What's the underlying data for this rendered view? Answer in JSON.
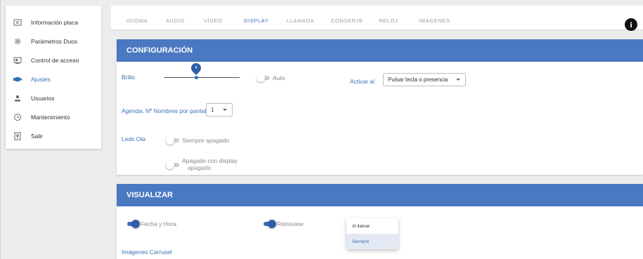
{
  "sidebar": {
    "items": [
      {
        "label": "Información placa",
        "icon": "board-info-icon"
      },
      {
        "label": "Parámetros Duox",
        "icon": "gear-icon"
      },
      {
        "label": "Control de acceso",
        "icon": "access-control-icon"
      },
      {
        "label": "Ajustes",
        "icon": "settings-sliders-icon"
      },
      {
        "label": "Usuarios",
        "icon": "user-icon"
      },
      {
        "label": "Mantenimiento",
        "icon": "maintenance-clock-icon"
      },
      {
        "label": "Salir",
        "icon": "exit-icon"
      }
    ],
    "active_index": 3
  },
  "tabs": [
    "IDIOMA",
    "AUDIO",
    "VÍDEO",
    "DISPLAY",
    "LLAMADA",
    "CONSERJE",
    "RELOJ",
    "IMÁGENES"
  ],
  "active_tab": "DISPLAY",
  "info_button": "i",
  "config": {
    "title": "CONFIGURACIÓN",
    "brillo_label": "Brillo",
    "brillo_value": "4",
    "brillo_fraction": 0.43,
    "auto_label": "Auto",
    "auto_on": false,
    "activar_label": "Activar al",
    "activar_value": "Pulsar tecla o presencia",
    "agenda_label": "Agenda. Nº Nombres por pantalla",
    "agenda_value": "1",
    "leds_label": "Leds Ola",
    "leds_option1": "Siempre apagado",
    "leds_option2_line1": "Apagado con display",
    "leds_option2_line2": "apagado"
  },
  "visualizar": {
    "title": "VISUALIZAR",
    "fecha_label": "Fecha y Hora",
    "fecha_on": true,
    "retroview_label": "Retroview",
    "retroview_on": true,
    "menu_options": [
      "Al llamar",
      "Siempre"
    ],
    "menu_selected": "Siempre",
    "carrusel_label": "Imágenes Carrusel"
  },
  "colors": {
    "accent": "#3a6fb7",
    "header_bar": "#4a78c1",
    "background": "#ececec"
  }
}
